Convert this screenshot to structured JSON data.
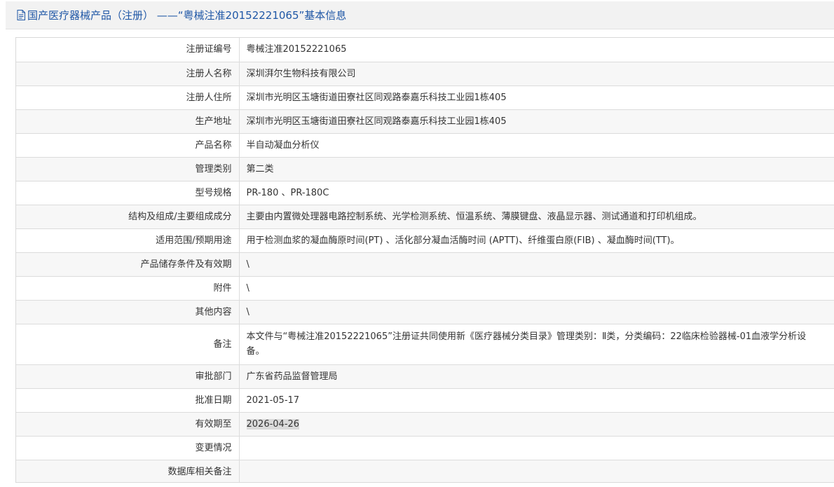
{
  "header": {
    "title": "国产医疗器械产品（注册） ——“粤械注准20152221065”基本信息",
    "icon": "document-icon"
  },
  "rows": [
    {
      "label": "注册证编号",
      "value": "粤械注准20152221065"
    },
    {
      "label": "注册人名称",
      "value": "深圳湃尔生物科技有限公司"
    },
    {
      "label": "注册人住所",
      "value": "深圳市光明区玉塘街道田寮社区同观路泰嘉乐科技工业园1栋405"
    },
    {
      "label": "生产地址",
      "value": "深圳市光明区玉塘街道田寮社区同观路泰嘉乐科技工业园1栋405"
    },
    {
      "label": "产品名称",
      "value": "半自动凝血分析仪"
    },
    {
      "label": "管理类别",
      "value": "第二类"
    },
    {
      "label": "型号规格",
      "value": "PR-180 、PR-180C"
    },
    {
      "label": "结构及组成/主要组成成分",
      "value": "主要由内置微处理器电路控制系统、光学检测系统、恒温系统、薄膜键盘、液晶显示器、测试通道和打印机组成。"
    },
    {
      "label": "适用范围/预期用途",
      "value": "用于检测血浆的凝血酶原时间(PT) 、活化部分凝血活酶时间 (APTT)、纤维蛋白原(FIB) 、凝血酶时间(TT)。"
    },
    {
      "label": "产品储存条件及有效期",
      "value": "\\"
    },
    {
      "label": "附件",
      "value": "\\"
    },
    {
      "label": "其他内容",
      "value": "\\"
    },
    {
      "label": "备注",
      "value": "本文件与“粤械注准20152221065”注册证共同使用新《医疗器械分类目录》管理类别：Ⅱ类，分类编码：22临床检验器械-01血液学分析设备。"
    },
    {
      "label": "审批部门",
      "value": "广东省药品监督管理局"
    },
    {
      "label": "批准日期",
      "value": "2021-05-17"
    },
    {
      "label": "有效期至",
      "value": "2026-04-26"
    },
    {
      "label": "变更情况",
      "value": ""
    },
    {
      "label": "数据库相关备注",
      "value": ""
    }
  ],
  "colors": {
    "title": "#1f57a6",
    "header_bg": "#f2f2f2",
    "zebra": "#f7f7f7",
    "border": "#dcdcdc",
    "highlight": "#dadada"
  }
}
